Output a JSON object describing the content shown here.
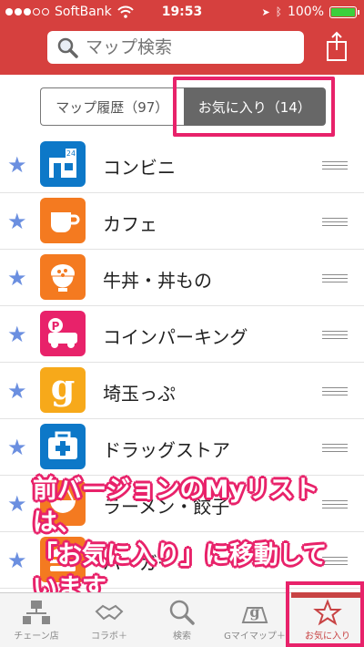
{
  "status": {
    "carrier": "SoftBank",
    "time": "19:53",
    "battery": "100%"
  },
  "search": {
    "placeholder": "マップ検索"
  },
  "segments": {
    "history": "マップ履歴（97）",
    "favorites": "お気に入り（14）"
  },
  "items": [
    {
      "label": "コンビニ",
      "color": "#0d78c8",
      "icon": "convenience-store-icon"
    },
    {
      "label": "カフェ",
      "color": "#f47a20",
      "icon": "coffee-cup-icon"
    },
    {
      "label": "牛丼・丼もの",
      "color": "#f47a20",
      "icon": "rice-bowl-icon"
    },
    {
      "label": "コインパーキング",
      "color": "#e8226a",
      "icon": "parking-car-icon"
    },
    {
      "label": "埼玉っぷ",
      "color": "#f7a91a",
      "icon": "g-letter-icon"
    },
    {
      "label": "ドラッグストア",
      "color": "#0d78c8",
      "icon": "first-aid-icon"
    },
    {
      "label": "ラーメン・餃子",
      "color": "#f47a20",
      "icon": "ramen-icon"
    },
    {
      "label": "バーガー",
      "color": "#f47a20",
      "icon": "burger-icon"
    }
  ],
  "annotation": {
    "line1": "前バージョンのMyリストは、",
    "line2": "「お気に入り」に移動して",
    "line3": "います"
  },
  "tabs": [
    "チェーン店",
    "コラボ＋",
    "検索",
    "Gマイマップ＋",
    "お気に入り"
  ],
  "colors": {
    "header": "#d6403e",
    "accent": "#e8226a",
    "star": "#6b8fe0"
  }
}
